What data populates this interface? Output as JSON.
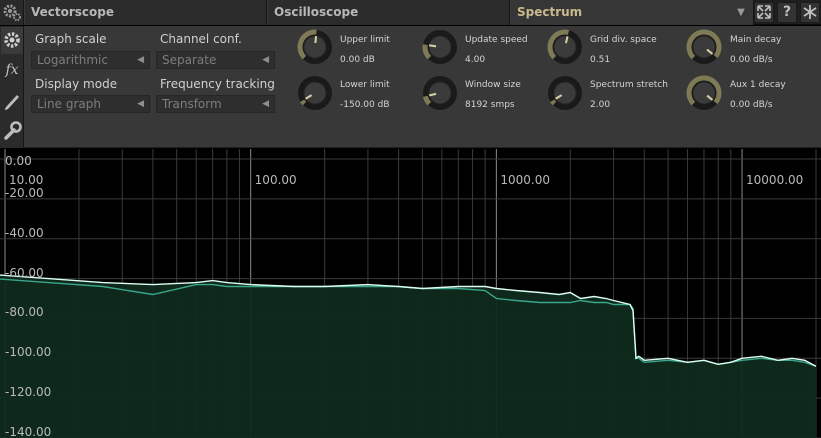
{
  "tabs": {
    "vectorscope": "Vectorscope",
    "oscilloscope": "Oscilloscope",
    "spectrum": "Spectrum"
  },
  "header_buttons": {
    "help": "?"
  },
  "left_column": {
    "fx_label": "fx"
  },
  "controls": {
    "graph_scale": {
      "label": "Graph scale",
      "value": "Logarithmic"
    },
    "channel_conf": {
      "label": "Channel conf.",
      "value": "Separate"
    },
    "display_mode": {
      "label": "Display mode",
      "value": "Line graph"
    },
    "frequency_tracking": {
      "label": "Frequency tracking",
      "value": "Transform"
    }
  },
  "knobs": {
    "upper_limit": {
      "label": "Upper limit",
      "value": "0.00 dB",
      "level": 0.52
    },
    "lower_limit": {
      "label": "Lower limit",
      "value": "-150.00 dB",
      "level": 0.05
    },
    "update_speed": {
      "label": "Update speed",
      "value": "4.00",
      "level": 0.2
    },
    "window_size": {
      "label": "Window size",
      "value": "8192 smps",
      "level": 0.12
    },
    "grid_div_space": {
      "label": "Grid div. space",
      "value": "0.51",
      "level": 0.55
    },
    "spectrum_stretch": {
      "label": "Spectrum stretch",
      "value": "2.00",
      "level": 0.05
    },
    "main_decay": {
      "label": "Main decay",
      "value": "0.00 dB/s",
      "level": 0.98
    },
    "aux1_decay": {
      "label": "Aux 1 decay",
      "value": "0.00 dB/s",
      "level": 0.98
    }
  },
  "colors": {
    "accent_tab": "#c9b98c",
    "knob_arc": "#7e7a55",
    "main_trace": "#dcfff4",
    "aux_trace": "#3aa58a",
    "fill": "#0f2a1e"
  },
  "chart_data": {
    "type": "line",
    "x_scale": "log",
    "xlim": [
      10,
      20000
    ],
    "ylim": [
      -140,
      0
    ],
    "x_tick_labels": [
      "10.00",
      "100.00",
      "1000.00",
      "10000.00"
    ],
    "y_tick_labels": [
      "0.00",
      "-20.00",
      "-40.00",
      "-60.00",
      "-80.00",
      "-100.00",
      "-120.00",
      "-140.00"
    ],
    "grid": true,
    "series": [
      {
        "x": [
          8,
          15,
          25,
          40,
          60,
          70,
          80,
          100,
          150,
          200,
          300,
          400,
          500,
          700,
          900,
          1000,
          1200,
          1500,
          1800,
          2000,
          2200,
          2500,
          2800,
          3000,
          3500,
          3600,
          3700,
          3800,
          4000,
          5000,
          6000,
          7000,
          8000,
          9000,
          10000,
          12000,
          14000,
          16000,
          18000,
          20000
        ],
        "y": [
          -58,
          -60,
          -62,
          -63,
          -62,
          -61,
          -62,
          -63,
          -64,
          -64,
          -63,
          -64,
          -65,
          -64,
          -64,
          -65,
          -66,
          -67,
          -68,
          -67,
          -70,
          -69,
          -70,
          -71,
          -73,
          -76,
          -100,
          -99,
          -101,
          -100,
          -102,
          -101,
          -103,
          -102,
          -100,
          -99,
          -101,
          -100,
          -101,
          -104
        ]
      },
      {
        "x": [
          8,
          15,
          25,
          40,
          60,
          70,
          80,
          100,
          150,
          200,
          300,
          400,
          500,
          700,
          900,
          1000,
          1200,
          1500,
          1800,
          2000,
          2200,
          2500,
          2800,
          3000,
          3500,
          3600,
          3700,
          3800,
          4000,
          5000,
          6000,
          7000,
          8000,
          9000,
          10000,
          12000,
          14000,
          16000,
          18000,
          20000
        ],
        "y": [
          -60,
          -62,
          -64,
          -68,
          -63,
          -63,
          -64,
          -64,
          -64,
          -64,
          -64,
          -64,
          -65,
          -65,
          -66,
          -70,
          -71,
          -72,
          -72,
          -72,
          -71,
          -72,
          -72,
          -73,
          -73,
          -75,
          -100,
          -100,
          -102,
          -101,
          -102,
          -101,
          -103,
          -102,
          -101,
          -100,
          -101,
          -101,
          -102,
          -104
        ]
      }
    ]
  }
}
